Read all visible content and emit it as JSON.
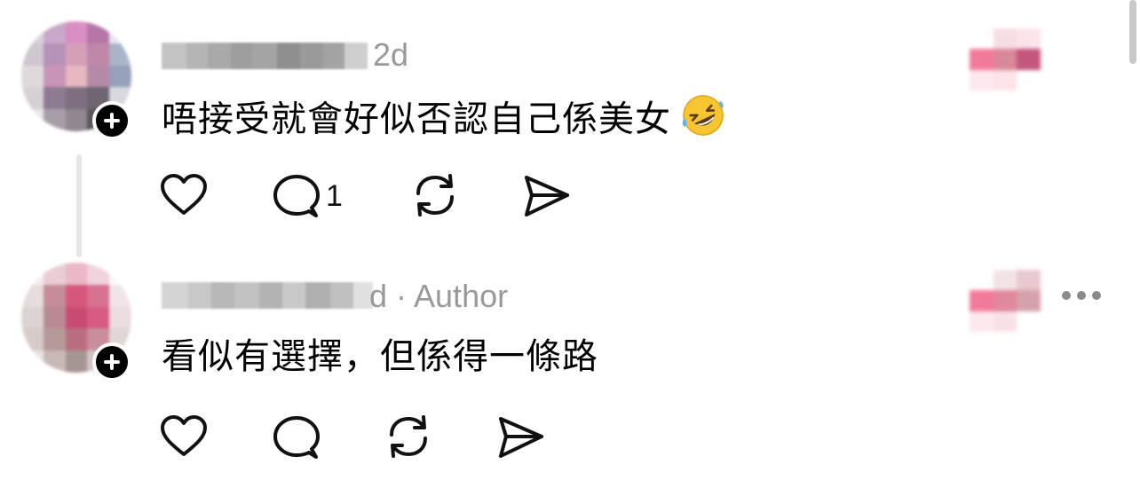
{
  "comments": [
    {
      "time": "2d",
      "author_tag": "",
      "text": "唔接受就會好似否認自己係美女",
      "emoji": "rolling-on-floor-laughing",
      "actions": {
        "like_count": "",
        "reply_count": "1",
        "repost_count": "",
        "share_count": ""
      }
    },
    {
      "time": "d · Author",
      "author_tag": "Author",
      "text": "看似有選擇，但係得一條路",
      "actions": {
        "like_count": "",
        "reply_count": "",
        "repost_count": "",
        "share_count": ""
      }
    }
  ],
  "icons": {
    "like": "heart-icon",
    "reply": "speech-bubble-icon",
    "repost": "repost-icon",
    "share": "send-icon",
    "follow": "plus-icon",
    "more": "more-horizontal-icon"
  },
  "colors": {
    "meta_text": "#999999",
    "icon_stroke": "#111111",
    "thread_line": "#e6e6e6"
  }
}
